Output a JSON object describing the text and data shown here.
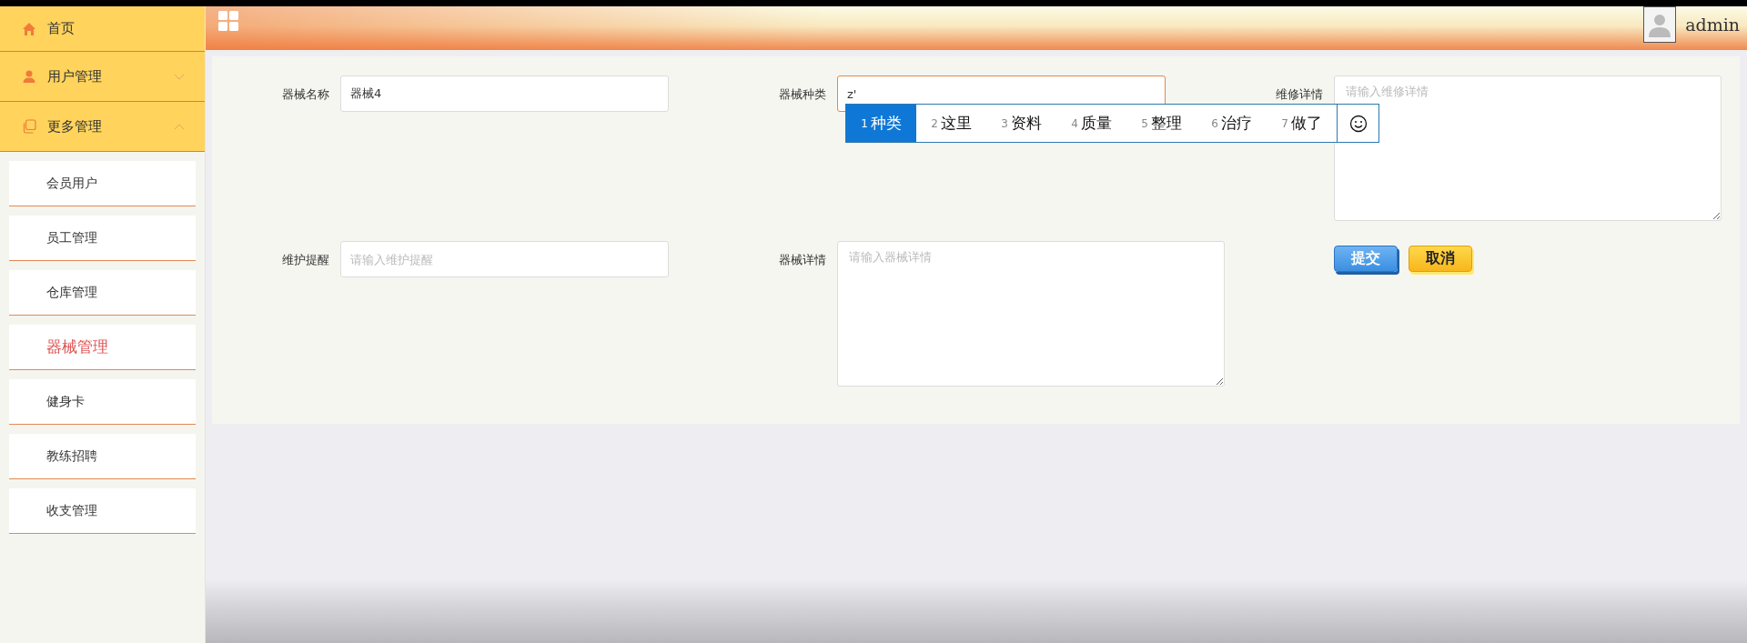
{
  "sidebar": {
    "items": [
      {
        "kind": "link",
        "label": "首页"
      },
      {
        "kind": "group",
        "label": "用户管理",
        "expanded": false
      },
      {
        "kind": "group",
        "label": "更多管理",
        "expanded": true,
        "children": [
          {
            "label": "会员用户",
            "selected": false
          },
          {
            "label": "员工管理",
            "selected": false
          },
          {
            "label": "仓库管理",
            "selected": false
          },
          {
            "label": "器械管理",
            "selected": true
          },
          {
            "label": "健身卡",
            "selected": false
          },
          {
            "label": "教练招聘",
            "selected": false
          },
          {
            "label": "收支管理",
            "selected": false
          }
        ]
      }
    ]
  },
  "header": {
    "user": "admin"
  },
  "form": {
    "fields": [
      {
        "label": "器械名称",
        "kind": "input",
        "value": "器械4",
        "focused": false
      },
      {
        "label": "器械种类",
        "kind": "input",
        "value": "z'",
        "focused": true
      },
      {
        "label": "维修详情",
        "kind": "textarea",
        "placeholder": "请输入维修详情",
        "focused": false
      },
      {
        "label": "维护提醒",
        "kind": "input",
        "placeholder": "请输入维护提醒",
        "focused": false
      },
      {
        "label": "器械详情",
        "kind": "textarea",
        "placeholder": "请输入器械详情",
        "focused": false
      }
    ],
    "buttons": [
      {
        "label": "提交",
        "kind": "primary"
      },
      {
        "label": "取消",
        "kind": "warning"
      }
    ]
  },
  "ime": {
    "candidates": [
      {
        "number": "1",
        "text": "种类",
        "selected": true
      },
      {
        "number": "2",
        "text": "这里",
        "selected": false
      },
      {
        "number": "3",
        "text": "资料",
        "selected": false
      },
      {
        "number": "4",
        "text": "质量",
        "selected": false
      },
      {
        "number": "5",
        "text": "整理",
        "selected": false
      },
      {
        "number": "6",
        "text": "治疗",
        "selected": false
      },
      {
        "number": "7",
        "text": "做了",
        "selected": false
      }
    ]
  }
}
